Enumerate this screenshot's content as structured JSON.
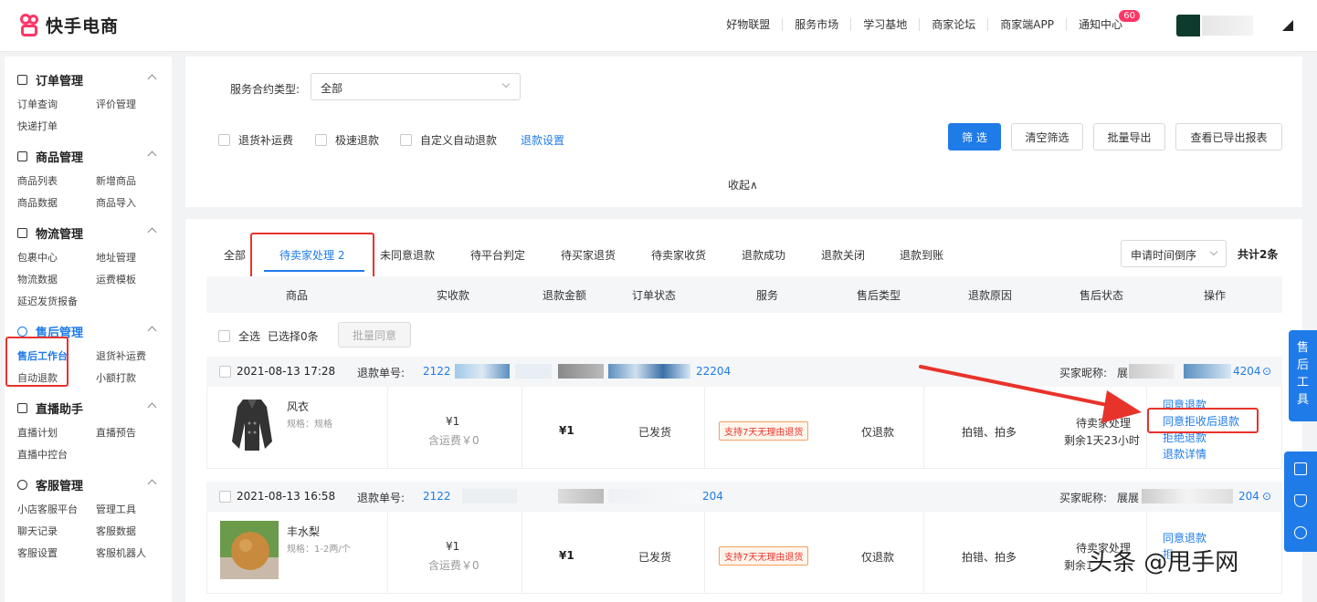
{
  "header": {
    "logo_text": "快手电商",
    "nav": [
      "好物联盟",
      "服务市场",
      "学习基地",
      "商家论坛",
      "商家端APP",
      "通知中心"
    ],
    "notice_badge": "60"
  },
  "sidebar": {
    "groups": [
      {
        "title": "订单管理",
        "items": [
          "订单查询",
          "评价管理",
          "快递打单"
        ]
      },
      {
        "title": "商品管理",
        "items": [
          "商品列表",
          "新增商品",
          "商品数据",
          "商品导入"
        ]
      },
      {
        "title": "物流管理",
        "items": [
          "包裹中心",
          "地址管理",
          "物流数据",
          "运费模板",
          "延迟发货报备"
        ]
      },
      {
        "title": "售后管理",
        "items": [
          "售后工作台",
          "退货补运费",
          "自动退款",
          "小额打款"
        ]
      },
      {
        "title": "直播助手",
        "items": [
          "直播计划",
          "直播预告",
          "直播中控台"
        ]
      },
      {
        "title": "客服管理",
        "items": [
          "小店客服平台",
          "管理工具",
          "聊天记录",
          "客服数据",
          "客服设置",
          "客服机器人"
        ]
      }
    ]
  },
  "filter": {
    "contract_label": "服务合约类型:",
    "contract_value": "全部",
    "checks": [
      "退货补运费",
      "极速退款",
      "自定义自动退款"
    ],
    "refund_settings": "退款设置",
    "buttons": {
      "filter": "筛 选",
      "clear": "清空筛选",
      "export": "批量导出",
      "view_export": "查看已导出报表"
    },
    "collapse": "收起∧"
  },
  "tabs": [
    "全部",
    "待卖家处理 2",
    "未同意退款",
    "待平台判定",
    "待买家退货",
    "待卖家收货",
    "退款成功",
    "退款关闭",
    "退款到账"
  ],
  "sort": "申请时间倒序",
  "total": "共计2条",
  "table": {
    "headers": [
      "商品",
      "实收款",
      "退款金额",
      "订单状态",
      "服务",
      "售后类型",
      "退款原因",
      "售后状态",
      "操作"
    ],
    "select_all": "全选",
    "selected": "已选择0条",
    "batch_agree": "批量同意"
  },
  "orders": [
    {
      "time": "2021-08-13 17:28",
      "refund_no_label": "退款单号:",
      "refund_no_start": "2122",
      "refund_no_end": "22204",
      "buyer_label": "买家昵称:",
      "buyer_prefix": "展",
      "buyer_suffix": "4204",
      "name": "风衣",
      "spec": "规格：规格",
      "paid": "¥1",
      "shipping": "含运费￥0",
      "refund": "¥1",
      "order_status": "已发货",
      "service": "支持7天无理由退货",
      "type": "仅退款",
      "reason": "拍错、拍多",
      "status": "待卖家处理",
      "remain": "剩余1天23小时",
      "ops": [
        "同意退款",
        "同意拒收后退款",
        "拒绝退款",
        "退款详情"
      ]
    },
    {
      "time": "2021-08-13 16:58",
      "refund_no_label": "退款单号:",
      "refund_no_start": "2122",
      "refund_no_end": "204",
      "buyer_label": "买家昵称:",
      "buyer_prefix": "展展",
      "buyer_suffix": "204",
      "name": "丰水梨",
      "spec": "规格：1-2两/个",
      "paid": "¥1",
      "shipping": "含运费￥0",
      "refund": "¥1",
      "order_status": "已发货",
      "service": "支持7天无理由退货",
      "type": "仅退款",
      "reason": "拍错、拍多",
      "status": "待卖家处理",
      "remain": "剩余1",
      "ops": [
        "同意退款",
        "拒"
      ]
    }
  ],
  "float_tool": "售后工具",
  "watermark": "头条 @甩手网"
}
